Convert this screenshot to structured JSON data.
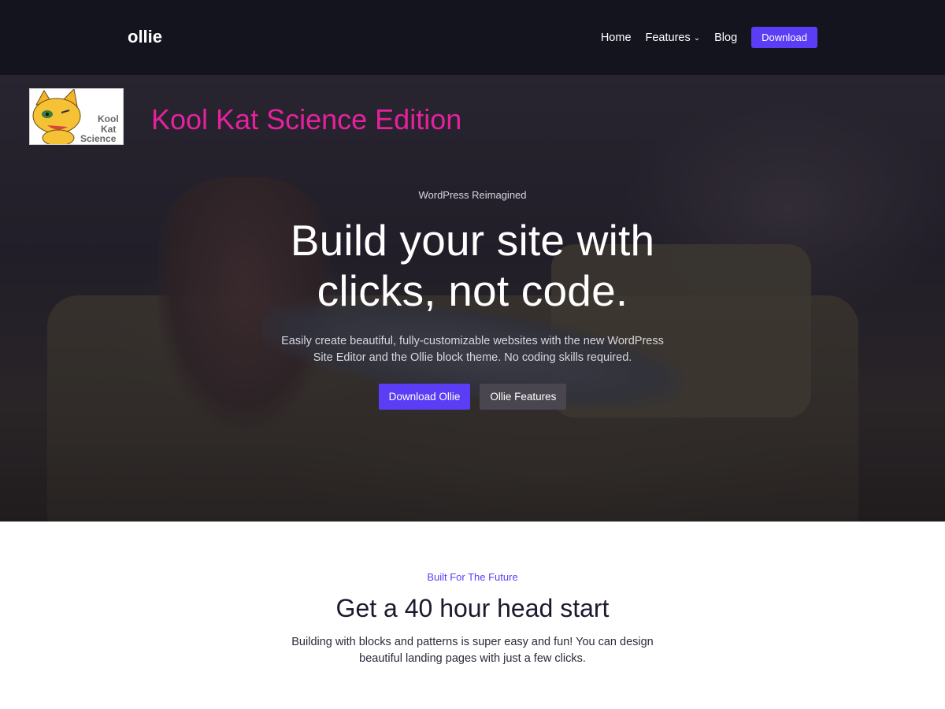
{
  "header": {
    "logo_text": "ollie",
    "nav": {
      "home": "Home",
      "features": "Features",
      "blog": "Blog",
      "download": "Download"
    }
  },
  "badge": {
    "image_text": [
      "Kool",
      "Kat",
      "Science"
    ],
    "title": "Kool Kat Science Edition"
  },
  "hero": {
    "eyebrow": "WordPress Reimagined",
    "title": "Build your site with clicks, not code.",
    "description": "Easily create beautiful, fully-customizable websites with the new WordPress Site Editor and the Ollie block theme. No coding skills required.",
    "primary_button": "Download Ollie",
    "secondary_button": "Ollie Features"
  },
  "section": {
    "eyebrow": "Built For The Future",
    "title": "Get a 40 hour head start",
    "description": "Building with blocks and patterns is super easy and fun! You can design beautiful landing pages with just a few clicks."
  },
  "colors": {
    "header_bg": "#14141f",
    "accent": "#5b3df5",
    "badge_title": "#e6219d"
  }
}
